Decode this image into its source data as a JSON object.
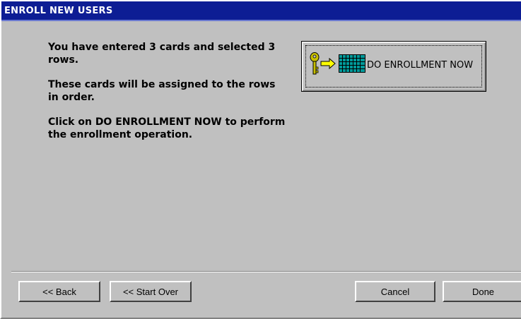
{
  "window": {
    "title": "ENROLL NEW USERS"
  },
  "instructions": [
    "You have entered 3 cards and selected 3 rows.",
    "These cards will be assigned to the rows in order.",
    "Click on DO ENROLLMENT NOW to perform the enrollment operation."
  ],
  "enroll_button": {
    "label": "DO ENROLLMENT NOW",
    "icons": [
      "key-icon",
      "arrow-right-icon",
      "grid-icon"
    ]
  },
  "footer": {
    "back_label": "<< Back",
    "start_over_label": "<< Start Over",
    "cancel_label": "Cancel",
    "done_label": "Done"
  },
  "colors": {
    "title_bar": "#0d1d94",
    "dialog_bg": "#c0c0c0",
    "key_color": "#c9c000",
    "arrow_color": "#ffff00",
    "grid_color": "#009a9a"
  }
}
